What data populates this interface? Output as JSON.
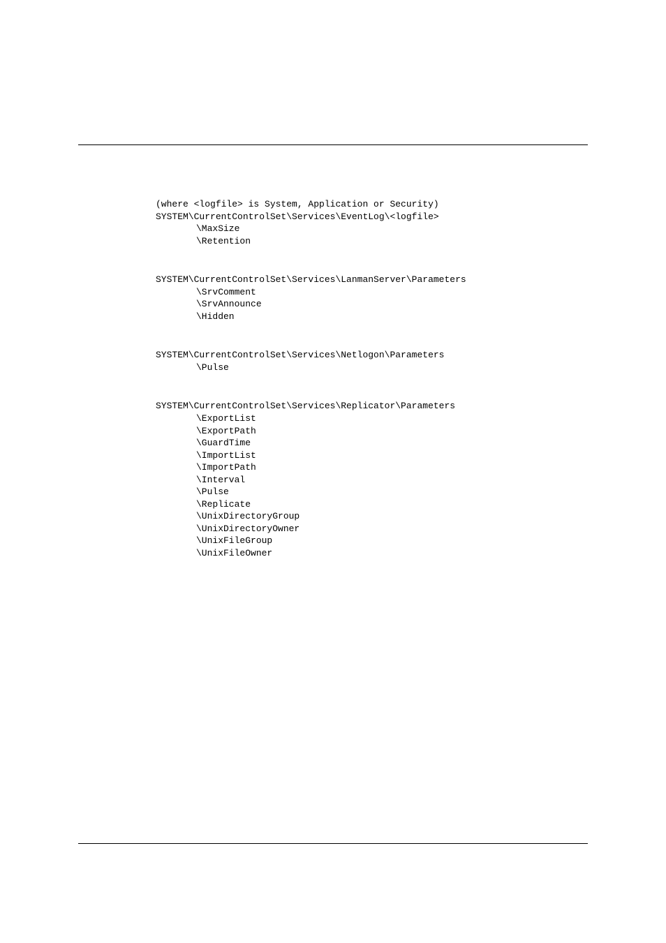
{
  "blocks": [
    {
      "header": [
        "(where <logfile> is System, Application or Security)",
        "SYSTEM\\CurrentControlSet\\Services\\EventLog\\<logfile>"
      ],
      "items": [
        "\\MaxSize",
        "\\Retention"
      ]
    },
    {
      "header": [
        "SYSTEM\\CurrentControlSet\\Services\\LanmanServer\\Parameters"
      ],
      "items": [
        "\\SrvComment",
        "\\SrvAnnounce",
        "\\Hidden"
      ]
    },
    {
      "header": [
        "SYSTEM\\CurrentControlSet\\Services\\Netlogon\\Parameters"
      ],
      "items": [
        "\\Pulse"
      ]
    },
    {
      "header": [
        "SYSTEM\\CurrentControlSet\\Services\\Replicator\\Parameters"
      ],
      "items": [
        "\\ExportList",
        "\\ExportPath",
        "\\GuardTime",
        "\\ImportList",
        "\\ImportPath",
        "\\Interval",
        "\\Pulse",
        "\\Replicate",
        "\\UnixDirectoryGroup",
        "\\UnixDirectoryOwner",
        "\\UnixFileGroup",
        "\\UnixFileOwner"
      ]
    }
  ]
}
